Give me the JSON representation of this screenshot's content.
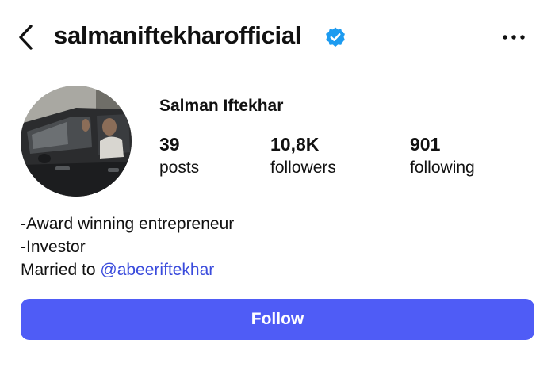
{
  "header": {
    "username": "salmaniftekharofficial",
    "verified_icon": "verified-badge-icon",
    "back_icon": "chevron-left-icon",
    "more_icon": "more-horizontal-icon",
    "verified_color": "#1d9bf0"
  },
  "profile": {
    "full_name": "Salman Iftekhar",
    "stats": [
      {
        "value": "39",
        "label": "posts"
      },
      {
        "value": "10,8K",
        "label": "followers"
      },
      {
        "value": "901",
        "label": "following"
      }
    ],
    "bio": {
      "line1": "-Award winning entrepreneur",
      "line2": "-Investor",
      "married_prefix": "Married to",
      "mention": "@abeeriftekhar"
    }
  },
  "actions": {
    "follow_label": "Follow"
  },
  "colors": {
    "accent": "#4f5cf6",
    "mention": "#3a4bdc",
    "text": "#111111"
  }
}
